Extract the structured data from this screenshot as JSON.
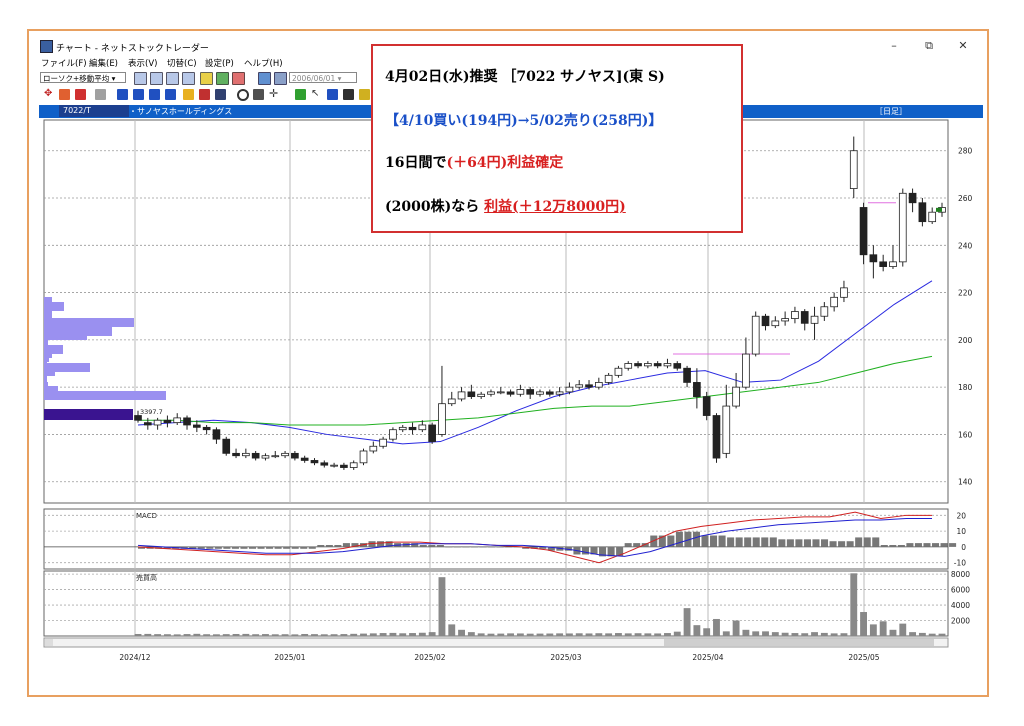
{
  "window": {
    "title": "チャート - ネットストックトレーダー",
    "minimize": "–",
    "maximize": "⧉",
    "close": "✕"
  },
  "menu": [
    "ファイル(F)",
    "編集(E)",
    "表示(V)",
    "切替(C)",
    "設定(P)",
    "ヘルプ(H)"
  ],
  "toolbar": {
    "indicator_select": "ローソク+移動平均",
    "date_field": "2006/06/01"
  },
  "header": {
    "code": "7022/T",
    "name": "・サノヤスホールディングス",
    "period": "［日足］"
  },
  "annotation": {
    "line1_prefix": "4月02日(水)推奨 ［7022 サノヤス](東 S)",
    "line2": "【4/10買い(194円)→5/02売り(258円)】",
    "line3_prefix": "16日間で",
    "line3_highlight": "(＋64円)利益確定",
    "line4_prefix": "(2000株)なら ",
    "line4_highlight": "利益(＋12万8000円)"
  },
  "chart_data": [
    {
      "type": "candlestick",
      "title": "",
      "price_axis_ticks": [
        140,
        160,
        180,
        200,
        220,
        240,
        260,
        280
      ],
      "ylim": [
        131,
        293
      ],
      "x_labels": [
        "2024/12",
        "2025/01",
        "2025/02",
        "2025/03",
        "2025/04",
        "2025/05"
      ],
      "volume_profile_label": "3397.7",
      "candles": [
        [
          168,
          166,
          170,
          165
        ],
        [
          165,
          164,
          167,
          162
        ],
        [
          164,
          166,
          167,
          162
        ],
        [
          166,
          165,
          168,
          163
        ],
        [
          165,
          167,
          169,
          164
        ],
        [
          167,
          164,
          168,
          162
        ],
        [
          164,
          163,
          166,
          161
        ],
        [
          163,
          162,
          164,
          160
        ],
        [
          162,
          158,
          163,
          156
        ],
        [
          158,
          152,
          159,
          151
        ],
        [
          152,
          151,
          154,
          150
        ],
        [
          151,
          152,
          154,
          150
        ],
        [
          152,
          150,
          153,
          149
        ],
        [
          150,
          151,
          152,
          149
        ],
        [
          151,
          151,
          153,
          150
        ],
        [
          151,
          152,
          153,
          150
        ],
        [
          152,
          150,
          153,
          149
        ],
        [
          150,
          149,
          151,
          148
        ],
        [
          149,
          148,
          150,
          147
        ],
        [
          148,
          147,
          149,
          146
        ],
        [
          147,
          147,
          148,
          146
        ],
        [
          147,
          146,
          148,
          145
        ],
        [
          146,
          148,
          149,
          145
        ],
        [
          148,
          153,
          154,
          147
        ],
        [
          153,
          155,
          157,
          152
        ],
        [
          155,
          158,
          159,
          154
        ],
        [
          158,
          162,
          163,
          157
        ],
        [
          162,
          163,
          164,
          161
        ],
        [
          163,
          162,
          165,
          160
        ],
        [
          162,
          164,
          166,
          161
        ],
        [
          164,
          157,
          165,
          156
        ],
        [
          160,
          173,
          189,
          159
        ],
        [
          173,
          175,
          178,
          172
        ],
        [
          175,
          178,
          180,
          174
        ],
        [
          178,
          176,
          181,
          175
        ],
        [
          176,
          177,
          178,
          175
        ],
        [
          177,
          178,
          179,
          176
        ],
        [
          178,
          178,
          180,
          177
        ],
        [
          178,
          177,
          179,
          176
        ],
        [
          177,
          179,
          181,
          176
        ],
        [
          179,
          177,
          180,
          175
        ],
        [
          177,
          178,
          179,
          176
        ],
        [
          178,
          177,
          179,
          176
        ],
        [
          177,
          178,
          180,
          176
        ],
        [
          178,
          180,
          182,
          177
        ],
        [
          180,
          181,
          183,
          179
        ],
        [
          181,
          180,
          183,
          179
        ],
        [
          180,
          182,
          184,
          179
        ],
        [
          182,
          185,
          186,
          181
        ],
        [
          185,
          188,
          189,
          184
        ],
        [
          188,
          190,
          191,
          187
        ],
        [
          190,
          189,
          191,
          188
        ],
        [
          189,
          190,
          191,
          188
        ],
        [
          190,
          189,
          191,
          188
        ],
        [
          189,
          190,
          192,
          188
        ],
        [
          190,
          188,
          191,
          187
        ],
        [
          188,
          182,
          189,
          180
        ],
        [
          182,
          176,
          188,
          171
        ],
        [
          176,
          168,
          178,
          166
        ],
        [
          168,
          150,
          169,
          148
        ],
        [
          152,
          172,
          181,
          150
        ],
        [
          172,
          180,
          186,
          171
        ],
        [
          180,
          194,
          201,
          179
        ],
        [
          194,
          210,
          212,
          193
        ],
        [
          210,
          206,
          211,
          204
        ],
        [
          206,
          208,
          210,
          205
        ],
        [
          208,
          209,
          212,
          206
        ],
        [
          209,
          212,
          214,
          207
        ],
        [
          212,
          207,
          213,
          204
        ],
        [
          207,
          210,
          214,
          200
        ],
        [
          210,
          214,
          216,
          208
        ],
        [
          214,
          218,
          220,
          212
        ],
        [
          218,
          222,
          225,
          216
        ],
        [
          264,
          280,
          286,
          260
        ],
        [
          256,
          236,
          258,
          232
        ],
        [
          236,
          233,
          240,
          226
        ],
        [
          233,
          231,
          236,
          229
        ],
        [
          231,
          233,
          240,
          230
        ],
        [
          233,
          262,
          264,
          231
        ],
        [
          262,
          258,
          264,
          254
        ],
        [
          258,
          250,
          260,
          248
        ],
        [
          250,
          254,
          256,
          249
        ],
        [
          254,
          256,
          258,
          252
        ]
      ],
      "moving_averages": [
        {
          "color": "#2a2ae0",
          "values": [
            164,
            165,
            166,
            165,
            163,
            160,
            158,
            156,
            157,
            163,
            170,
            176,
            180,
            183,
            186,
            187,
            182,
            183,
            191,
            203,
            215,
            225
          ]
        },
        {
          "color": "#20b020",
          "values": [
            166,
            166,
            165,
            165,
            164,
            164,
            164,
            165,
            166,
            167,
            169,
            171,
            172,
            172,
            174,
            176,
            178,
            180,
            182,
            186,
            190,
            193
          ]
        }
      ]
    },
    {
      "type": "line",
      "title": "MACD",
      "ticks": [
        20,
        10,
        0,
        -10
      ],
      "ylim": [
        -14,
        24
      ],
      "series": [
        {
          "color": "#d02020",
          "values": [
            0,
            -1,
            -2,
            -3,
            -4,
            -5,
            -5,
            -3,
            -1,
            2,
            3,
            3,
            2,
            2,
            1,
            0,
            -2,
            -6,
            -10,
            -4,
            3,
            10,
            13,
            15,
            17,
            18,
            19,
            19,
            22,
            18,
            20,
            20
          ]
        },
        {
          "color": "#2020d0",
          "values": [
            1,
            0,
            -1,
            -2,
            -3,
            -4,
            -4,
            -4,
            -3,
            -1,
            1,
            2,
            2,
            2,
            1,
            1,
            0,
            -2,
            -5,
            -6,
            -3,
            2,
            7,
            10,
            12,
            14,
            15,
            16,
            17,
            17,
            18,
            18
          ]
        }
      ]
    },
    {
      "type": "bar",
      "title": "売買高",
      "ticks": [
        8000,
        6000,
        4000,
        2000
      ],
      "ylim": [
        0,
        8400
      ],
      "values": [
        260,
        270,
        240,
        230,
        210,
        250,
        280,
        230,
        220,
        240,
        260,
        270,
        230,
        250,
        220,
        230,
        210,
        260,
        240,
        220,
        230,
        250,
        280,
        310,
        340,
        380,
        400,
        350,
        380,
        420,
        500,
        7600,
        1500,
        800,
        500,
        340,
        300,
        310,
        340,
        330,
        300,
        310,
        320,
        340,
        330,
        350,
        330,
        360,
        340,
        380,
        340,
        360,
        340,
        330,
        380,
        560,
        3600,
        1400,
        1000,
        2200,
        600,
        2000,
        800,
        600,
        600,
        500,
        420,
        380,
        360,
        500,
        400,
        340,
        360,
        8100,
        3100,
        1500,
        1900,
        800,
        1600,
        500,
        400,
        300,
        300
      ]
    }
  ]
}
